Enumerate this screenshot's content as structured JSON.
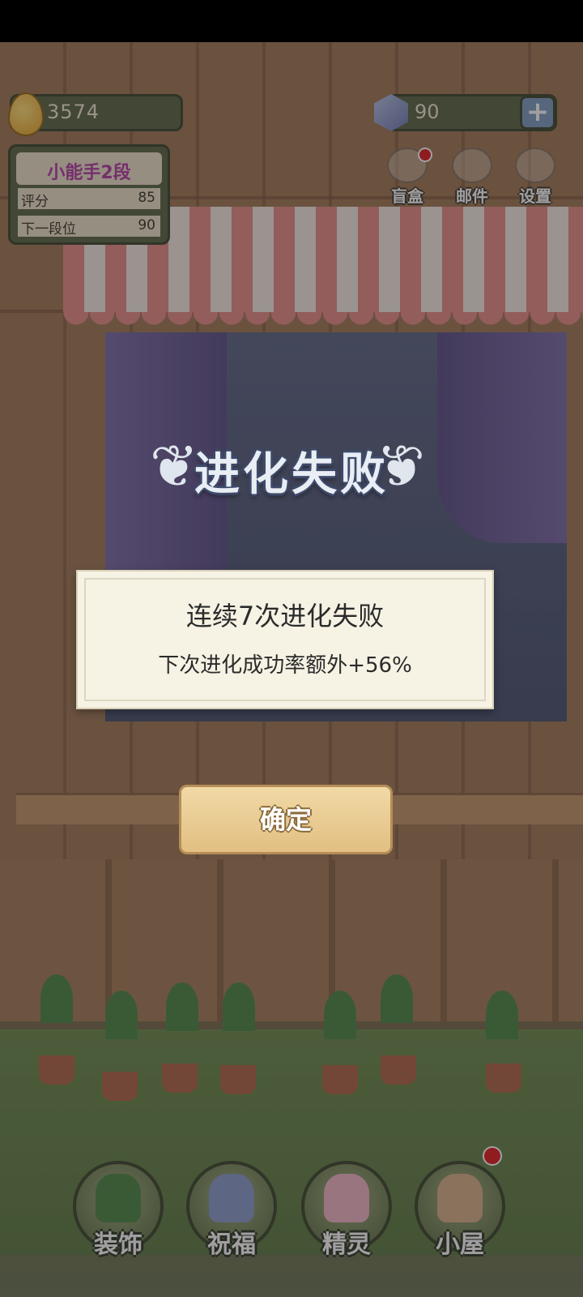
{
  "hud": {
    "coins": "3574",
    "gems": "90",
    "gem_plus": "+"
  },
  "rank": {
    "title": "小能手2段",
    "score_label": "评分",
    "score_value": "85",
    "next_label": "下一段位",
    "next_value": "90"
  },
  "top_buttons": {
    "blind_box": "盲盒",
    "mail": "邮件",
    "settings": "设置"
  },
  "dialog": {
    "title": "进化失败",
    "line1": "连续7次进化失败",
    "line2": "下次进化成功率额外+56%",
    "confirm": "确定"
  },
  "nav": {
    "decorate": "装饰",
    "bless": "祝福",
    "spirit": "精灵",
    "house": "小屋"
  },
  "colors": {
    "dialog_bg": "#f6f2e4",
    "button": "#e2bf82",
    "rank_title": "#b53fa6",
    "badge": "#e02020"
  }
}
